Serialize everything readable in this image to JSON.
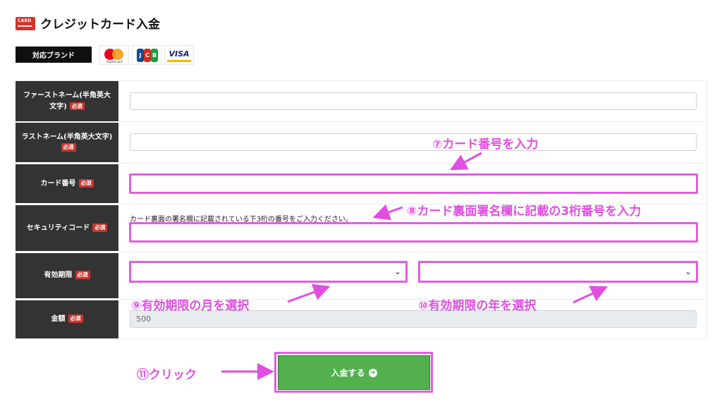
{
  "header": {
    "card_icon_text": "CARD",
    "title": "クレジットカード入金"
  },
  "brands": {
    "label": "対応ブランド",
    "mastercard_text": "mastercard",
    "jcb_letters": [
      "J",
      "C",
      "B"
    ],
    "visa_text": "VISA"
  },
  "form": {
    "required_badge": "必須",
    "first_name_label": "ファーストネーム(半角英大文字)",
    "first_name_value": "",
    "last_name_label": "ラストネーム(半角英大文字)",
    "last_name_value": "",
    "card_number_label": "カード番号",
    "card_number_value": "",
    "security_code_label": "セキュリティコード",
    "security_code_help": "カード裏面の署名欄に記載されている下3桁の番号をご入力ください。",
    "security_code_value": "",
    "expiry_label": "有効期限",
    "expiry_month_value": "",
    "expiry_year_value": "",
    "amount_label": "金額",
    "amount_value": "500",
    "submit_label": "入金する"
  },
  "annotations": {
    "step7": "⑦カード番号を入力",
    "step8": "⑧カード裏面署名欄に記載の3桁番号を入力",
    "step9": "⑨有効期限の月を選択",
    "step10": "⑩有効期限の年を選択",
    "step11": "⑪クリック"
  },
  "colors": {
    "annotation": "#e14fe1",
    "label_bg": "#333333",
    "required_badge": "#c8342c",
    "submit_bg": "#52b04d"
  },
  "icons": {
    "card": "credit-card-icon",
    "submit_arrow": "arrow-circle-right-icon",
    "chevron": "chevron-down-icon"
  }
}
